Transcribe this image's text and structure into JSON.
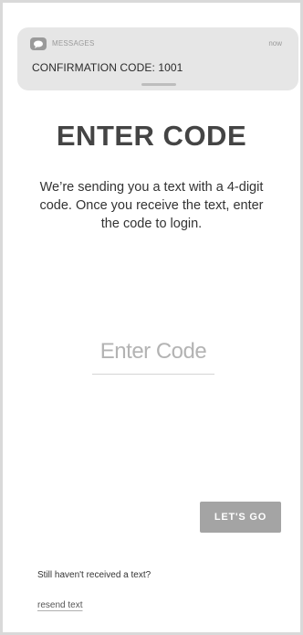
{
  "notification": {
    "app_icon": "messages-icon",
    "app_name": "MESSAGES",
    "time": "now",
    "body": "CONFIRMATION CODE: 1001"
  },
  "main": {
    "title": "ENTER CODE",
    "instructions": "We’re sending you a text with a 4-digit code. Once you receive the text, enter the code to login.",
    "code_input": {
      "value": "",
      "placeholder": "Enter Code"
    },
    "submit_label": "LET'S GO"
  },
  "footer": {
    "help_text": "Still haven't received a text?",
    "resend_label": "resend text"
  },
  "colors": {
    "button_bg": "#a4a4a4",
    "notification_bg": "#e6e6e6",
    "title": "#444444"
  }
}
